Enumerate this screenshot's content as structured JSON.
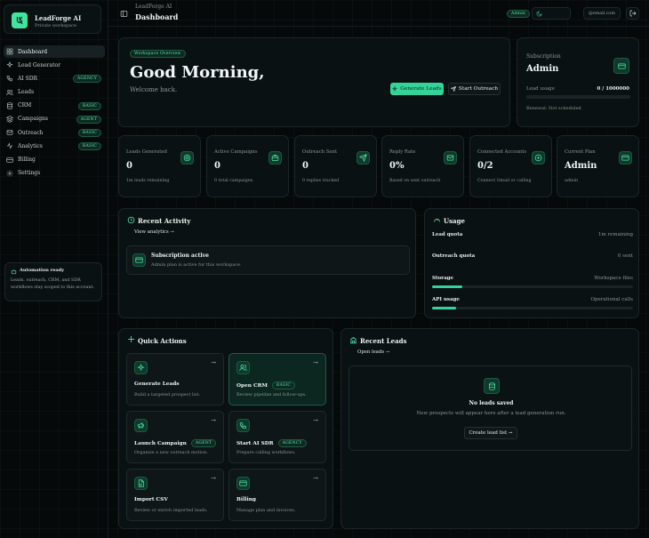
{
  "brand": {
    "name": "LeadForge AI",
    "subtitle": "Private workspace"
  },
  "sidebar": {
    "items": [
      {
        "label": "Dashboard",
        "icon": "grid-icon",
        "badge": ""
      },
      {
        "label": "Lead Generator",
        "icon": "sparkles-icon",
        "badge": ""
      },
      {
        "label": "AI SDR",
        "icon": "phone-icon",
        "badge": "AGENCY"
      },
      {
        "label": "Leads",
        "icon": "users-icon",
        "badge": ""
      },
      {
        "label": "CRM",
        "icon": "database-icon",
        "badge": "BASIC"
      },
      {
        "label": "Campaigns",
        "icon": "layers-icon",
        "badge": "AGENT"
      },
      {
        "label": "Outreach",
        "icon": "mail-icon",
        "badge": "BASIC"
      },
      {
        "label": "Analytics",
        "icon": "activity-icon",
        "badge": "BASIC"
      },
      {
        "label": "Billing",
        "icon": "card-icon",
        "badge": ""
      },
      {
        "label": "Settings",
        "icon": "gear-icon",
        "badge": ""
      }
    ],
    "automation": {
      "title": "Automation ready",
      "text": "Leads, outreach, CRM, and SDR workflows stay scoped to this account."
    }
  },
  "topbar": {
    "app": "LeadForge AI",
    "page": "Dashboard",
    "role_badge": "Admin",
    "email": "@email.com"
  },
  "hero": {
    "badge": "Workspace Overview",
    "greeting": "Good Morning,",
    "welcome": "Welcome back.",
    "primary_button": "Generate Leads",
    "secondary_button": "Start Outreach"
  },
  "subscription": {
    "label": "Subscription",
    "plan": "Admin",
    "usage_label": "Lead usage",
    "usage_value": "0 / 1000000",
    "usage_fraction": 0,
    "renewal": "Renewal: Not scheduled"
  },
  "stats": [
    {
      "label": "Leads Generated",
      "value": "0",
      "note": "1m leads remaining",
      "icon": "target-icon"
    },
    {
      "label": "Active Campaigns",
      "value": "0",
      "note": "0 total campaigns",
      "icon": "briefcase-icon"
    },
    {
      "label": "Outreach Sent",
      "value": "0",
      "note": "0 replies tracked",
      "icon": "send-icon"
    },
    {
      "label": "Reply Rate",
      "value": "0%",
      "note": "Based on sent outreach",
      "icon": "mail-icon"
    },
    {
      "label": "Connected Accounts",
      "value": "0/2",
      "note": "Connect Gmail or calling",
      "icon": "plus-circle-icon"
    },
    {
      "label": "Current Plan",
      "value": "Admin",
      "note": "admin",
      "icon": "card-icon"
    }
  ],
  "activity": {
    "title": "Recent Activity",
    "link": "View analytics",
    "item_title": "Subscription active",
    "item_text": "Admin plan is active for this workspace."
  },
  "usage": {
    "title": "Usage",
    "rows": [
      {
        "label": "Lead quota",
        "value": "1m remaining",
        "fraction": 0
      },
      {
        "label": "Outreach quota",
        "value": "0 sent",
        "fraction": 0
      },
      {
        "label": "Storage",
        "value": "Workspace files",
        "fraction": 0.15
      },
      {
        "label": "API usage",
        "value": "Operational calls",
        "fraction": 0.12
      }
    ]
  },
  "quick_actions": {
    "title": "Quick Actions",
    "items": [
      {
        "title": "Generate Leads",
        "text": "Build a targeted prospect list.",
        "badge": "",
        "icon": "sparkles-icon"
      },
      {
        "title": "Open CRM",
        "text": "Review pipeline and follow-ups.",
        "badge": "BASIC",
        "icon": "users-icon"
      },
      {
        "title": "Launch Campaign",
        "text": "Organize a new outreach motion.",
        "badge": "AGENT",
        "icon": "megaphone-icon"
      },
      {
        "title": "Start AI SDR",
        "text": "Prepare calling workflows.",
        "badge": "AGENCY",
        "icon": "phone-icon"
      },
      {
        "title": "Import CSV",
        "text": "Review or enrich imported leads.",
        "badge": "",
        "icon": "file-icon"
      },
      {
        "title": "Billing",
        "text": "Manage plan and invoices.",
        "badge": "",
        "icon": "card-icon"
      }
    ]
  },
  "recent_leads": {
    "title": "Recent Leads",
    "link": "Open leads",
    "empty_title": "No leads saved",
    "empty_text": "New prospects will appear here after a lead generation run.",
    "button": "Create lead list"
  },
  "colors": {
    "accent": "#34d399",
    "background": "#05090a",
    "card": "#0a1112"
  }
}
